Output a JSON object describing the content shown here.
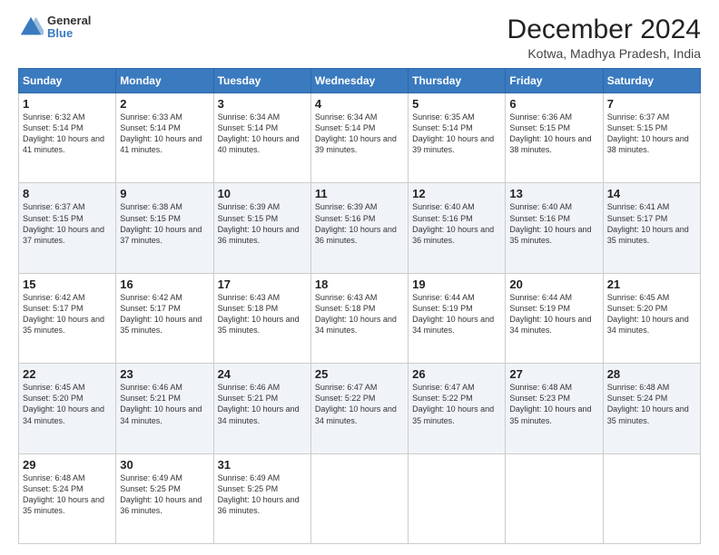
{
  "header": {
    "logo_line1": "General",
    "logo_line2": "Blue",
    "title": "December 2024",
    "subtitle": "Kotwa, Madhya Pradesh, India"
  },
  "columns": [
    "Sunday",
    "Monday",
    "Tuesday",
    "Wednesday",
    "Thursday",
    "Friday",
    "Saturday"
  ],
  "weeks": [
    [
      {
        "day": "1",
        "text": "Sunrise: 6:32 AM\nSunset: 5:14 PM\nDaylight: 10 hours and 41 minutes."
      },
      {
        "day": "2",
        "text": "Sunrise: 6:33 AM\nSunset: 5:14 PM\nDaylight: 10 hours and 41 minutes."
      },
      {
        "day": "3",
        "text": "Sunrise: 6:34 AM\nSunset: 5:14 PM\nDaylight: 10 hours and 40 minutes."
      },
      {
        "day": "4",
        "text": "Sunrise: 6:34 AM\nSunset: 5:14 PM\nDaylight: 10 hours and 39 minutes."
      },
      {
        "day": "5",
        "text": "Sunrise: 6:35 AM\nSunset: 5:14 PM\nDaylight: 10 hours and 39 minutes."
      },
      {
        "day": "6",
        "text": "Sunrise: 6:36 AM\nSunset: 5:15 PM\nDaylight: 10 hours and 38 minutes."
      },
      {
        "day": "7",
        "text": "Sunrise: 6:37 AM\nSunset: 5:15 PM\nDaylight: 10 hours and 38 minutes."
      }
    ],
    [
      {
        "day": "8",
        "text": "Sunrise: 6:37 AM\nSunset: 5:15 PM\nDaylight: 10 hours and 37 minutes."
      },
      {
        "day": "9",
        "text": "Sunrise: 6:38 AM\nSunset: 5:15 PM\nDaylight: 10 hours and 37 minutes."
      },
      {
        "day": "10",
        "text": "Sunrise: 6:39 AM\nSunset: 5:15 PM\nDaylight: 10 hours and 36 minutes."
      },
      {
        "day": "11",
        "text": "Sunrise: 6:39 AM\nSunset: 5:16 PM\nDaylight: 10 hours and 36 minutes."
      },
      {
        "day": "12",
        "text": "Sunrise: 6:40 AM\nSunset: 5:16 PM\nDaylight: 10 hours and 36 minutes."
      },
      {
        "day": "13",
        "text": "Sunrise: 6:40 AM\nSunset: 5:16 PM\nDaylight: 10 hours and 35 minutes."
      },
      {
        "day": "14",
        "text": "Sunrise: 6:41 AM\nSunset: 5:17 PM\nDaylight: 10 hours and 35 minutes."
      }
    ],
    [
      {
        "day": "15",
        "text": "Sunrise: 6:42 AM\nSunset: 5:17 PM\nDaylight: 10 hours and 35 minutes."
      },
      {
        "day": "16",
        "text": "Sunrise: 6:42 AM\nSunset: 5:17 PM\nDaylight: 10 hours and 35 minutes."
      },
      {
        "day": "17",
        "text": "Sunrise: 6:43 AM\nSunset: 5:18 PM\nDaylight: 10 hours and 35 minutes."
      },
      {
        "day": "18",
        "text": "Sunrise: 6:43 AM\nSunset: 5:18 PM\nDaylight: 10 hours and 34 minutes."
      },
      {
        "day": "19",
        "text": "Sunrise: 6:44 AM\nSunset: 5:19 PM\nDaylight: 10 hours and 34 minutes."
      },
      {
        "day": "20",
        "text": "Sunrise: 6:44 AM\nSunset: 5:19 PM\nDaylight: 10 hours and 34 minutes."
      },
      {
        "day": "21",
        "text": "Sunrise: 6:45 AM\nSunset: 5:20 PM\nDaylight: 10 hours and 34 minutes."
      }
    ],
    [
      {
        "day": "22",
        "text": "Sunrise: 6:45 AM\nSunset: 5:20 PM\nDaylight: 10 hours and 34 minutes."
      },
      {
        "day": "23",
        "text": "Sunrise: 6:46 AM\nSunset: 5:21 PM\nDaylight: 10 hours and 34 minutes."
      },
      {
        "day": "24",
        "text": "Sunrise: 6:46 AM\nSunset: 5:21 PM\nDaylight: 10 hours and 34 minutes."
      },
      {
        "day": "25",
        "text": "Sunrise: 6:47 AM\nSunset: 5:22 PM\nDaylight: 10 hours and 34 minutes."
      },
      {
        "day": "26",
        "text": "Sunrise: 6:47 AM\nSunset: 5:22 PM\nDaylight: 10 hours and 35 minutes."
      },
      {
        "day": "27",
        "text": "Sunrise: 6:48 AM\nSunset: 5:23 PM\nDaylight: 10 hours and 35 minutes."
      },
      {
        "day": "28",
        "text": "Sunrise: 6:48 AM\nSunset: 5:24 PM\nDaylight: 10 hours and 35 minutes."
      }
    ],
    [
      {
        "day": "29",
        "text": "Sunrise: 6:48 AM\nSunset: 5:24 PM\nDaylight: 10 hours and 35 minutes."
      },
      {
        "day": "30",
        "text": "Sunrise: 6:49 AM\nSunset: 5:25 PM\nDaylight: 10 hours and 36 minutes."
      },
      {
        "day": "31",
        "text": "Sunrise: 6:49 AM\nSunset: 5:25 PM\nDaylight: 10 hours and 36 minutes."
      },
      null,
      null,
      null,
      null
    ]
  ]
}
